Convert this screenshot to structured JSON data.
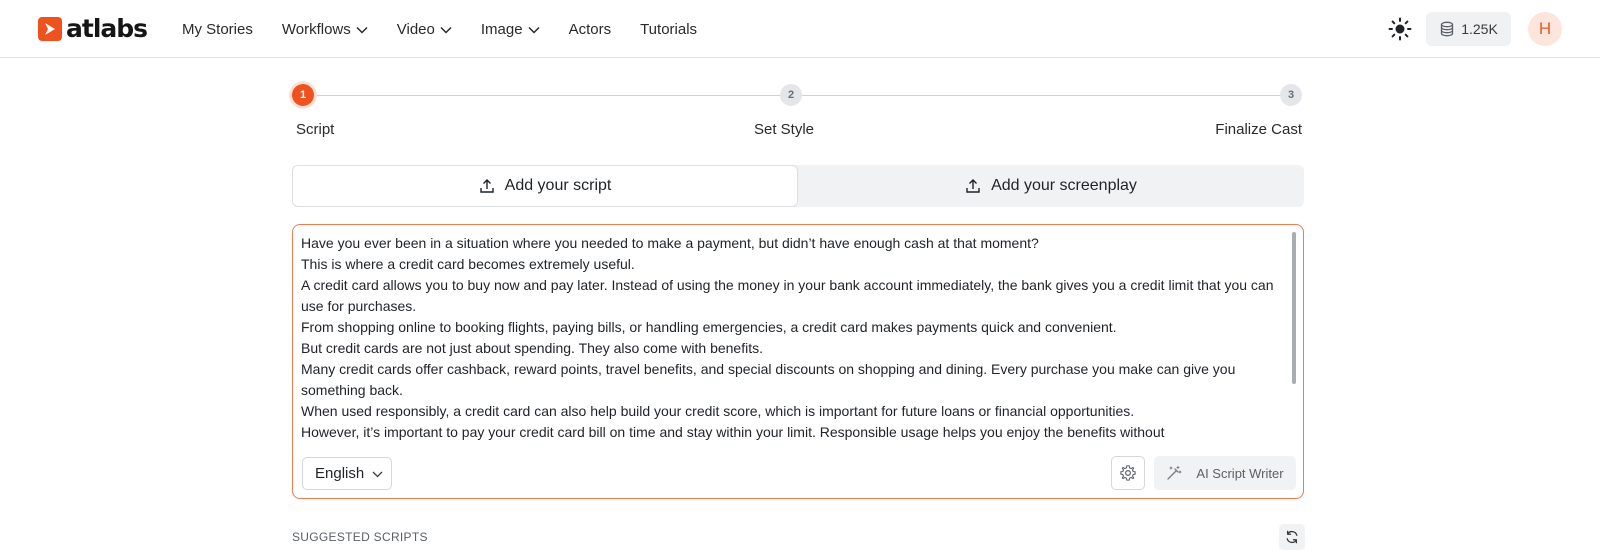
{
  "brand": {
    "name": "atlabs",
    "accent": "#f0521f"
  },
  "nav": {
    "items": [
      {
        "label": "My Stories",
        "dropdown": false
      },
      {
        "label": "Workflows",
        "dropdown": true
      },
      {
        "label": "Video",
        "dropdown": true
      },
      {
        "label": "Image",
        "dropdown": true
      },
      {
        "label": "Actors",
        "dropdown": false
      },
      {
        "label": "Tutorials",
        "dropdown": false
      }
    ]
  },
  "header": {
    "theme_icon": "sun-icon",
    "credits": "1.25K",
    "credits_icon": "coins-icon",
    "avatar_initial": "H"
  },
  "stepper": {
    "steps": [
      {
        "number": "1",
        "label": "Script",
        "active": true
      },
      {
        "number": "2",
        "label": "Set Style",
        "active": false
      },
      {
        "number": "3",
        "label": "Finalize Cast",
        "active": false
      }
    ]
  },
  "tabs": [
    {
      "label": "Add your script",
      "icon": "upload-icon",
      "active": true
    },
    {
      "label": "Add your screenplay",
      "icon": "upload-icon",
      "active": false
    }
  ],
  "editor": {
    "lines": [
      "Have you ever been in a situation where you needed to make a payment, but didn’t have enough cash at that moment?",
      "This is where a credit card becomes extremely useful.",
      "A credit card allows you to buy now and pay later. Instead of using the money in your bank account immediately, the bank gives you a credit limit that you can use for purchases.",
      "From shopping online to booking flights, paying bills, or handling emergencies, a credit card makes payments quick and convenient.",
      "But credit cards are not just about spending. They also come with benefits.",
      "Many credit cards offer cashback, reward points, travel benefits, and special discounts on shopping and dining. Every purchase you make can give you something back.",
      "When used responsibly, a credit card can also help build your credit score, which is important for future loans or financial opportunities.",
      "However, it’s important to pay your credit card bill on time and stay within your limit. Responsible usage helps you enjoy the benefits without"
    ],
    "language": "English",
    "settings_icon": "gear-icon",
    "ai_button_label": "AI Script Writer",
    "ai_icon": "magic-wand-icon",
    "scroll_position": 0.0
  },
  "suggested": {
    "heading": "SUGGESTED SCRIPTS",
    "refresh_icon": "refresh-icon"
  }
}
